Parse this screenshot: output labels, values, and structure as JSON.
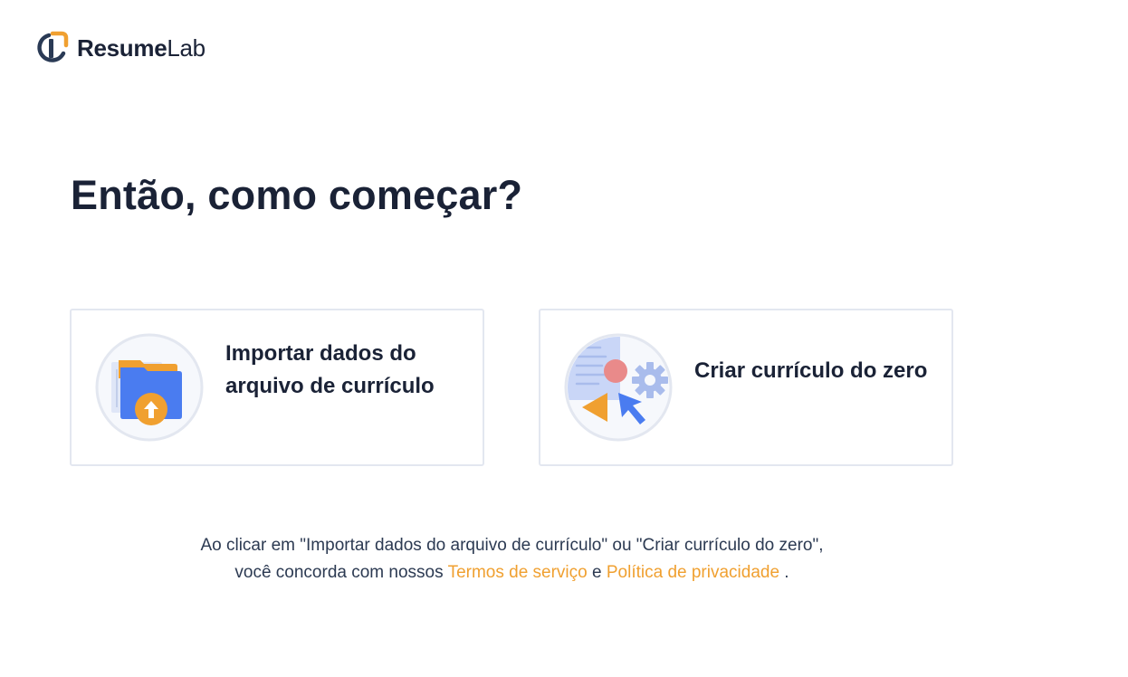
{
  "logo": {
    "bold": "Resume",
    "light": "Lab"
  },
  "heading": "Então, como começar?",
  "cards": [
    {
      "label": "Importar dados do arquivo de currículo",
      "icon": "folder-upload-icon"
    },
    {
      "label": "Criar currículo do zero",
      "icon": "create-from-scratch-icon"
    }
  ],
  "terms": {
    "line1": "Ao clicar em \"Importar dados do arquivo de currículo\" ou \"Criar currículo do zero\",",
    "line2_prefix": "você concorda com nossos ",
    "terms_link": "Termos de serviço",
    "conjunction": " e ",
    "privacy_link": "Política de privacidade",
    "line2_suffix": " ."
  },
  "colors": {
    "text": "#1a2236",
    "accent_orange": "#f0a030",
    "card_border": "#e3e7f0",
    "icon_blue": "#4a7cf0"
  }
}
